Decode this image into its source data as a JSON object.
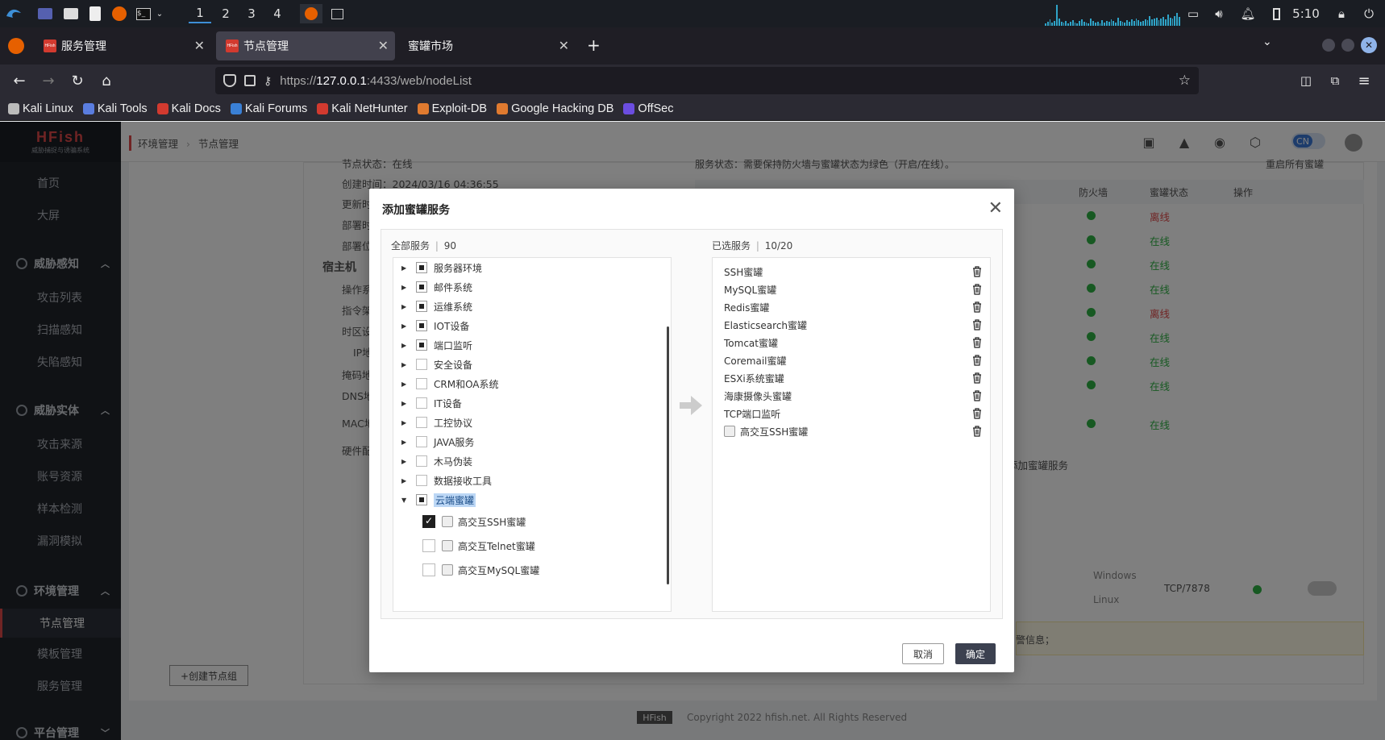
{
  "taskbar": {
    "workspaces": [
      "1",
      "2",
      "3",
      "4"
    ],
    "clock": "5:10"
  },
  "browser": {
    "tabs": [
      {
        "label": "服务管理",
        "favicon": "HFish"
      },
      {
        "label": "节点管理",
        "favicon": "HFish"
      },
      {
        "label": "蜜罐市场",
        "favicon": ""
      }
    ],
    "url_prefix": "https://",
    "url_host": "127.0.0.1",
    "url_rest": ":4433/web/nodeList",
    "bookmarks": [
      "Kali Linux",
      "Kali Tools",
      "Kali Docs",
      "Kali Forums",
      "Kali NetHunter",
      "Exploit-DB",
      "Google Hacking DB",
      "OffSec"
    ]
  },
  "app": {
    "logo": "HFish",
    "logo_sub": "威胁捕捉与诱骗系统",
    "breadcrumb": [
      "环境管理",
      "节点管理"
    ],
    "lang": "CN",
    "sidebar": {
      "top": [
        "首页",
        "大屏"
      ],
      "groups": [
        {
          "label": "威胁感知",
          "items": [
            "攻击列表",
            "扫描感知",
            "失陷感知"
          ]
        },
        {
          "label": "威胁实体",
          "items": [
            "攻击来源",
            "账号资源",
            "样本检测",
            "漏洞模拟"
          ]
        },
        {
          "label": "环境管理",
          "items": [
            "节点管理",
            "模板管理",
            "服务管理"
          ]
        },
        {
          "label": "平台管理",
          "items": []
        }
      ]
    },
    "background": {
      "node_status": "节点状态：在线",
      "created": "创建时间：2024/03/16 04:36:55",
      "labels": [
        "更新时",
        "部署时",
        "部署位",
        "宿主机",
        "操作系",
        "指令架",
        "时区设",
        "IP地",
        "掩码地",
        "DNS地",
        "MAC地",
        "硬件配"
      ],
      "service_status_note": "服务状态：需要保持防火墙与蜜罐状态为绿色（开启/在线）。",
      "restart_all": "重启所有蜜罐",
      "col_firewall": "防火墙",
      "col_status": "蜜罐状态",
      "col_ops": "操作",
      "statuses": [
        "离线",
        "在线",
        "在线",
        "在线",
        "离线",
        "在线",
        "在线",
        "在线",
        "在线"
      ],
      "add_service": "添加蜜罐服务",
      "create_group": "+创建节点组",
      "os_windows": "Windows",
      "os_linux": "Linux",
      "port": "TCP/7878",
      "alert_info": "警信息；",
      "footer_logo": "HFish",
      "footer_copy": "Copyright 2022 hfish.net. All Rights Reserved"
    }
  },
  "modal": {
    "title": "添加蜜罐服务",
    "left_header_label": "全部服务",
    "left_header_count": "90",
    "right_header_label": "已选服务",
    "right_header_count": "10/20",
    "tree": [
      {
        "label": "服务器环境",
        "state": "partial"
      },
      {
        "label": "邮件系统",
        "state": "partial"
      },
      {
        "label": "运维系统",
        "state": "partial"
      },
      {
        "label": "IOT设备",
        "state": "partial"
      },
      {
        "label": "端口监听",
        "state": "partial"
      },
      {
        "label": "安全设备",
        "state": "empty"
      },
      {
        "label": "CRM和OA系统",
        "state": "empty"
      },
      {
        "label": "IT设备",
        "state": "empty"
      },
      {
        "label": "工控协议",
        "state": "empty"
      },
      {
        "label": "JAVA服务",
        "state": "empty"
      },
      {
        "label": "木马伪装",
        "state": "empty"
      },
      {
        "label": "数据接收工具",
        "state": "empty"
      },
      {
        "label": "云端蜜罐",
        "state": "partial",
        "expanded": true
      }
    ],
    "cloud_children": [
      {
        "label": "高交互SSH蜜罐",
        "checked": true
      },
      {
        "label": "高交互Telnet蜜罐",
        "checked": false
      },
      {
        "label": "高交互MySQL蜜罐",
        "checked": false
      }
    ],
    "selected": [
      "SSH蜜罐",
      "MySQL蜜罐",
      "Redis蜜罐",
      "Elasticsearch蜜罐",
      "Tomcat蜜罐",
      "Coremail蜜罐",
      "ESXi系统蜜罐",
      "海康摄像头蜜罐",
      "TCP端口监听",
      "高交互SSH蜜罐"
    ],
    "cancel": "取消",
    "confirm": "确定"
  }
}
